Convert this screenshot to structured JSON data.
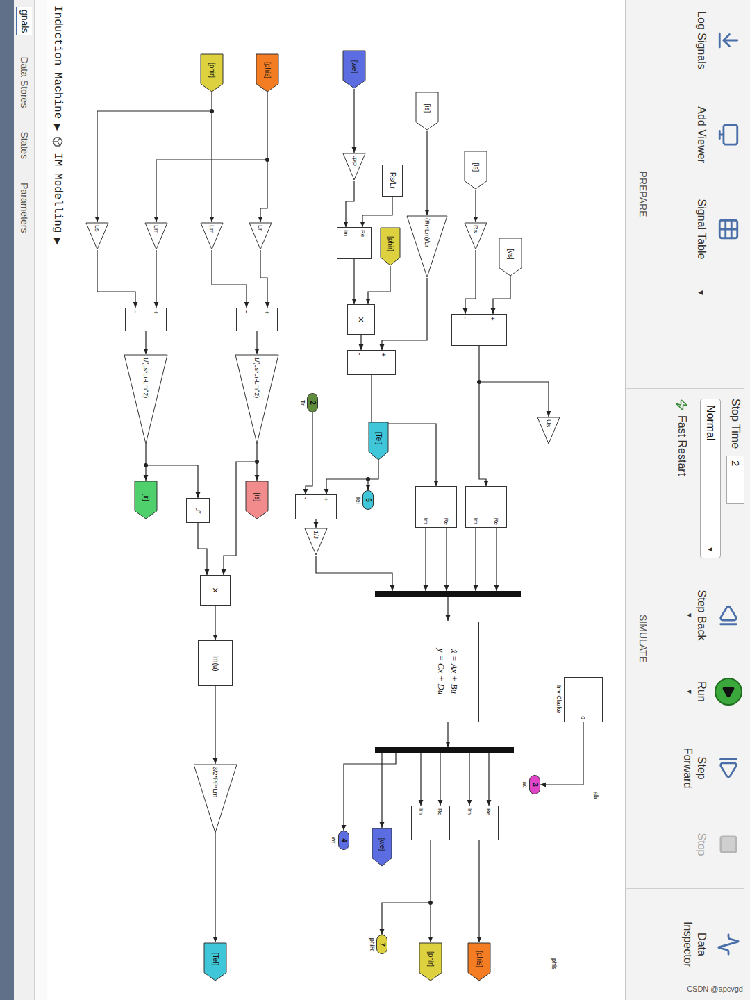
{
  "toolstrip": {
    "prepare": {
      "label": "PREPARE",
      "items": [
        {
          "label": "Log Signals"
        },
        {
          "label": "Add Viewer"
        },
        {
          "label": "Signal Table"
        }
      ],
      "expander": "▾"
    },
    "simulate": {
      "label": "SIMULATE",
      "stop_time": {
        "label": "Stop Time",
        "value": "2"
      },
      "mode": {
        "value": "Normal",
        "arrow": "▾"
      },
      "fast_restart": {
        "label": "Fast Restart"
      },
      "buttons": [
        {
          "label": "Step Back",
          "arrow": "▾",
          "disabled": false
        },
        {
          "label": "Run",
          "arrow": "▾",
          "disabled": false
        },
        {
          "label": "Step Forward",
          "disabled": false
        },
        {
          "label": "Stop",
          "disabled": true
        }
      ]
    },
    "review": {
      "items": [
        {
          "label": "Data Inspector"
        }
      ]
    }
  },
  "diagram": {
    "blocks": [
      {
        "kind": "from",
        "label": "[vs]",
        "color": "#ffffff"
      },
      {
        "kind": "from",
        "label": "[is]",
        "color": "#ffffff"
      },
      {
        "kind": "gain",
        "label": "Rs"
      },
      {
        "kind": "sum",
        "signs": [
          "+",
          "-"
        ]
      },
      {
        "kind": "from",
        "label": "[is]",
        "color": "#ffffff"
      },
      {
        "kind": "gain",
        "label": "(Rr*Lm)/Lr"
      },
      {
        "kind": "block",
        "label": "Rs/Lr"
      },
      {
        "kind": "from",
        "label": "[phir]",
        "color": "#ddd13f"
      },
      {
        "kind": "from",
        "label": "[we]",
        "color": "#5b6de0"
      },
      {
        "kind": "gain",
        "label": "-PP"
      },
      {
        "kind": "ri2c",
        "ports": [
          "Re",
          "Im"
        ]
      },
      {
        "kind": "product",
        "label": "×"
      },
      {
        "kind": "sum",
        "signs": [
          "+",
          "-"
        ]
      },
      {
        "kind": "inport",
        "label": "2",
        "caption": "Tr",
        "color": "#5e8c3c"
      },
      {
        "kind": "from",
        "label": "[Tel]",
        "color": "#3fc6d8"
      },
      {
        "kind": "outport",
        "label": "5",
        "caption": "Tel",
        "color": "#3fc6d8"
      },
      {
        "kind": "sum",
        "signs": [
          "+",
          "-"
        ]
      },
      {
        "kind": "gain",
        "label": "1/J"
      },
      {
        "kind": "c2ri",
        "ports": [
          "Re",
          "Im"
        ]
      },
      {
        "kind": "c2ri",
        "ports": [
          "Re",
          "Im"
        ]
      },
      {
        "kind": "gain",
        "label": "Us"
      },
      {
        "kind": "bar"
      },
      {
        "kind": "statespace",
        "lines": [
          "ẋ = Ax + Bu",
          "y = Cx + Du"
        ]
      },
      {
        "kind": "bar"
      },
      {
        "kind": "ri2c",
        "ports": [
          "Re",
          "Im"
        ]
      },
      {
        "kind": "ri2c",
        "ports": [
          "Re",
          "Im"
        ]
      },
      {
        "kind": "goto",
        "label": "[we]",
        "color": "#5b6de0"
      },
      {
        "kind": "outport",
        "label": "4",
        "caption": "wr",
        "color": "#5b6de0"
      },
      {
        "kind": "goto",
        "label": "[phis]",
        "color": "#f47c22"
      },
      {
        "kind": "goto",
        "label": "[phir]",
        "color": "#ddd13f"
      },
      {
        "kind": "outport",
        "label": "7",
        "caption": "phiR",
        "color": "#ddd13f"
      },
      {
        "kind": "outport",
        "label": "3",
        "caption": "ac",
        "color": "#e244c8"
      },
      {
        "kind": "subsystem",
        "label": "Inv Clarke",
        "port": "c"
      },
      {
        "kind": "from",
        "label": "[phis]",
        "color": "#f47c22"
      },
      {
        "kind": "from",
        "label": "[phir]",
        "color": "#ddd13f"
      },
      {
        "kind": "gain",
        "label": "Lr"
      },
      {
        "kind": "gain",
        "label": "Lm"
      },
      {
        "kind": "gain",
        "label": "Lm"
      },
      {
        "kind": "gain",
        "label": "Ls"
      },
      {
        "kind": "sum",
        "signs": [
          "+",
          "-"
        ]
      },
      {
        "kind": "sum",
        "signs": [
          "+",
          "-"
        ]
      },
      {
        "kind": "gain",
        "label": "1/(Ls*Lr-Lm^2)"
      },
      {
        "kind": "gain",
        "label": "1/(Ls*Lr-Lm^2)"
      },
      {
        "kind": "goto",
        "label": "[is]",
        "color": "#f28c8c"
      },
      {
        "kind": "goto",
        "label": "[ir]",
        "color": "#4fd06c"
      },
      {
        "kind": "block",
        "label": "u*"
      },
      {
        "kind": "product",
        "label": "×"
      },
      {
        "kind": "block",
        "label": "Im(u)"
      },
      {
        "kind": "gain",
        "label": "3/2*PP*Lm"
      },
      {
        "kind": "goto",
        "label": "[Tel]",
        "color": "#3fc6d8"
      }
    ],
    "signal_labels": [
      {
        "text": "ab"
      },
      {
        "text": "phis"
      }
    ]
  },
  "breadcrumb": {
    "items": [
      "Induction Machine",
      "IM Modelling"
    ],
    "separator": "▶"
  },
  "editor_tabs": [
    {
      "label": "gnals",
      "selected": true
    },
    {
      "label": "Data Stores",
      "selected": false
    },
    {
      "label": "States",
      "selected": false
    },
    {
      "label": "Parameters",
      "selected": false
    }
  ],
  "watermark": "CSDN @apcvgd"
}
